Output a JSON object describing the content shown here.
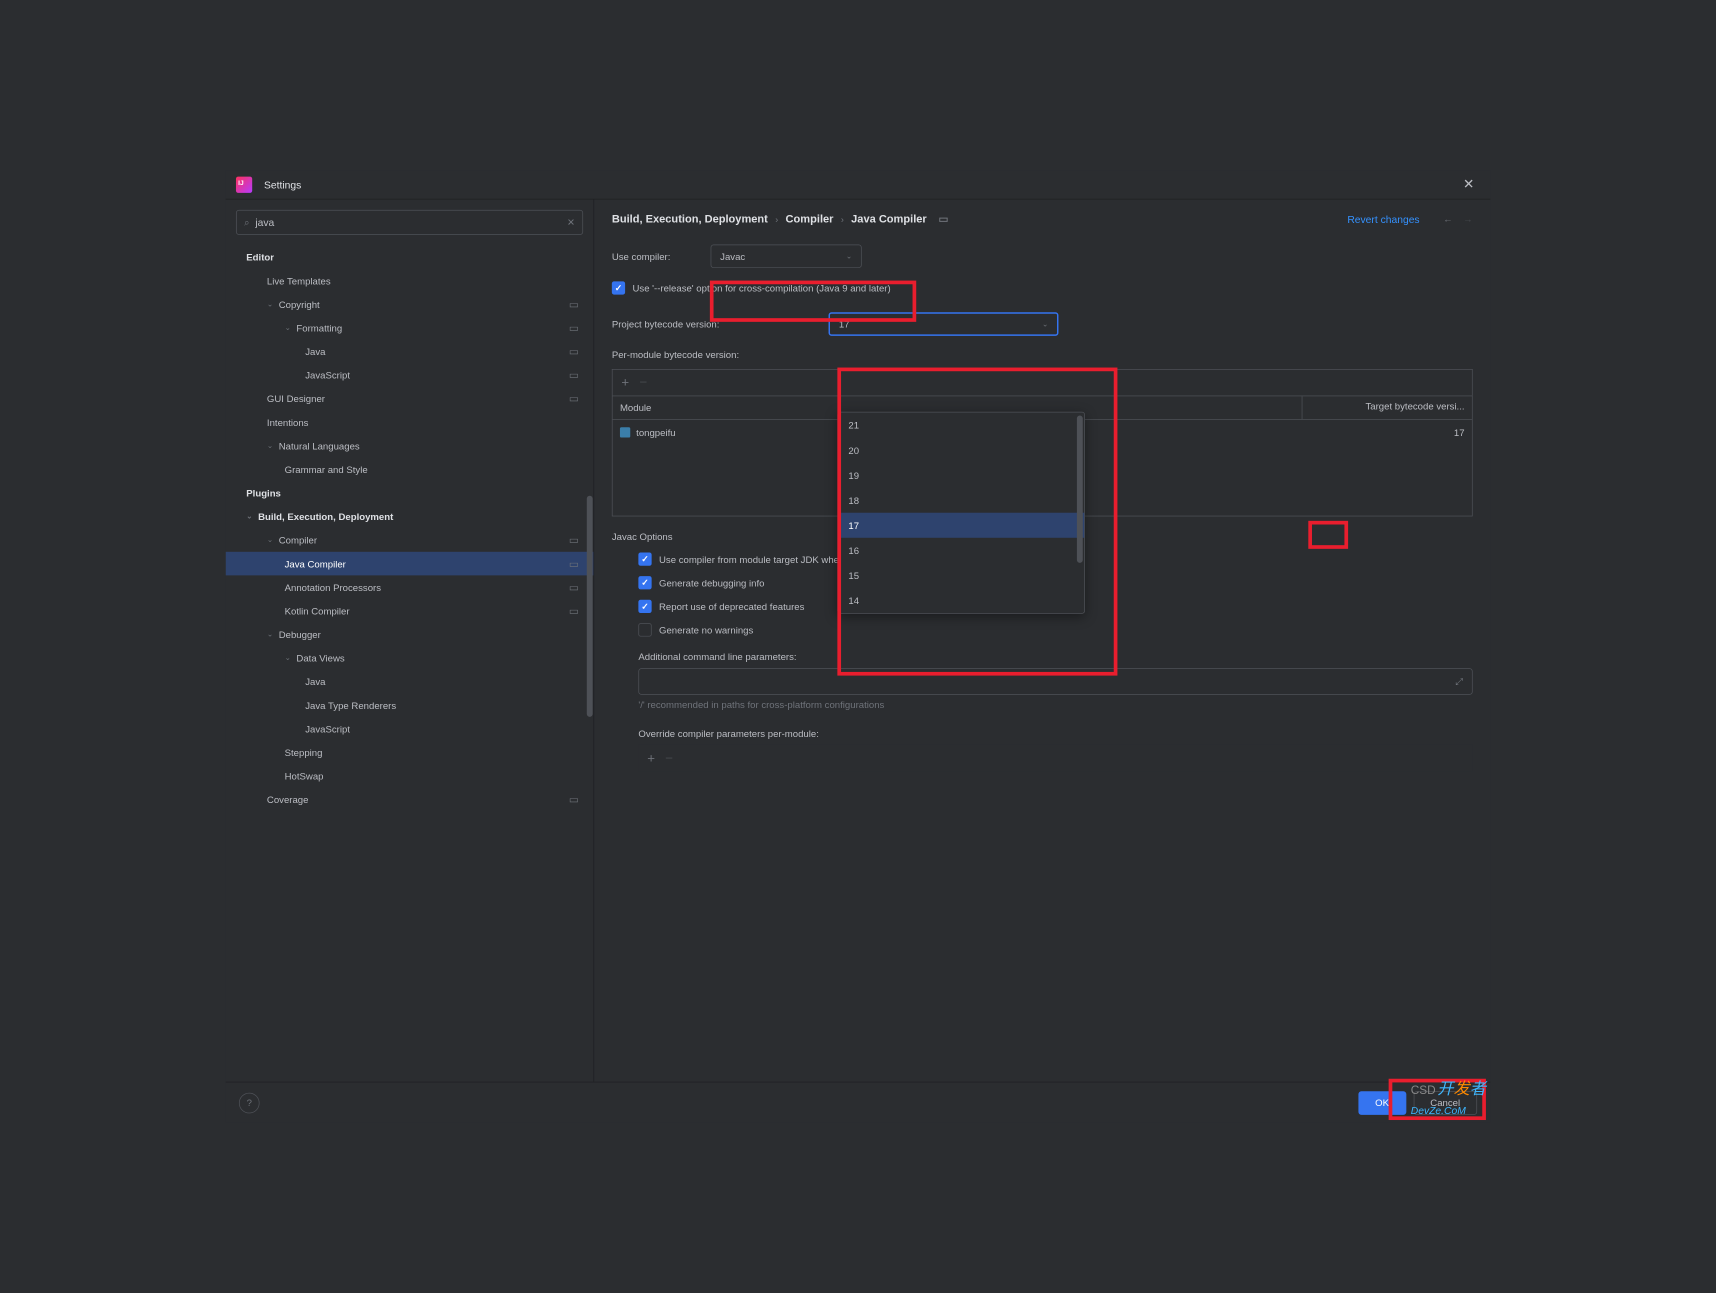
{
  "window": {
    "title": "Settings"
  },
  "search": {
    "value": "java"
  },
  "tree": {
    "editor": "Editor",
    "live_templates": "Live Templates",
    "copyright": "Copyright",
    "formatting": "Formatting",
    "java": "Java",
    "javascript": "JavaScript",
    "gui_designer": "GUI Designer",
    "intentions": "Intentions",
    "natural_languages": "Natural Languages",
    "grammar_style": "Grammar and Style",
    "plugins": "Plugins",
    "build": "Build, Execution, Deployment",
    "compiler": "Compiler",
    "java_compiler": "Java Compiler",
    "annotation": "Annotation Processors",
    "kotlin": "Kotlin Compiler",
    "debugger": "Debugger",
    "data_views": "Data Views",
    "java2": "Java",
    "java_type": "Java Type Renderers",
    "javascript2": "JavaScript",
    "stepping": "Stepping",
    "hotswap": "HotSwap",
    "coverage": "Coverage",
    "scope_marker": "▭"
  },
  "breadcrumb": {
    "p1": "Build, Execution, Deployment",
    "p2": "Compiler",
    "p3": "Java Compiler"
  },
  "actions": {
    "revert": "Revert changes"
  },
  "form": {
    "use_compiler_label": "Use compiler:",
    "use_compiler_value": "Javac",
    "cross_compile": "Use '--release' option for cross-compilation (Java 9 and later)",
    "project_bytecode_label": "Project bytecode version:",
    "project_bytecode_value": "17",
    "per_module_label": "Per-module bytecode version:",
    "table": {
      "col_module": "Module",
      "col_target": "Target bytecode versi...",
      "row1_module": "tongpeifu",
      "row1_target": "17"
    },
    "dropdown_options": [
      "21",
      "20",
      "19",
      "18",
      "17",
      "16",
      "15",
      "14"
    ],
    "javac_options": "Javac Options",
    "opt_module_target": "Use compiler from module target JDK when possible",
    "opt_debug": "Generate debugging info",
    "opt_deprecated": "Report use of deprecated features",
    "opt_no_warnings": "Generate no warnings",
    "additional_params_label": "Additional command line parameters:",
    "additional_params_hint": "'/' recommended in paths for cross-platform configurations",
    "override_label": "Override compiler parameters per-module:"
  },
  "footer": {
    "ok": "OK",
    "cancel": "Cancel"
  },
  "watermark": {
    "text": "DevZe.CoM",
    "csd": "CSD"
  }
}
